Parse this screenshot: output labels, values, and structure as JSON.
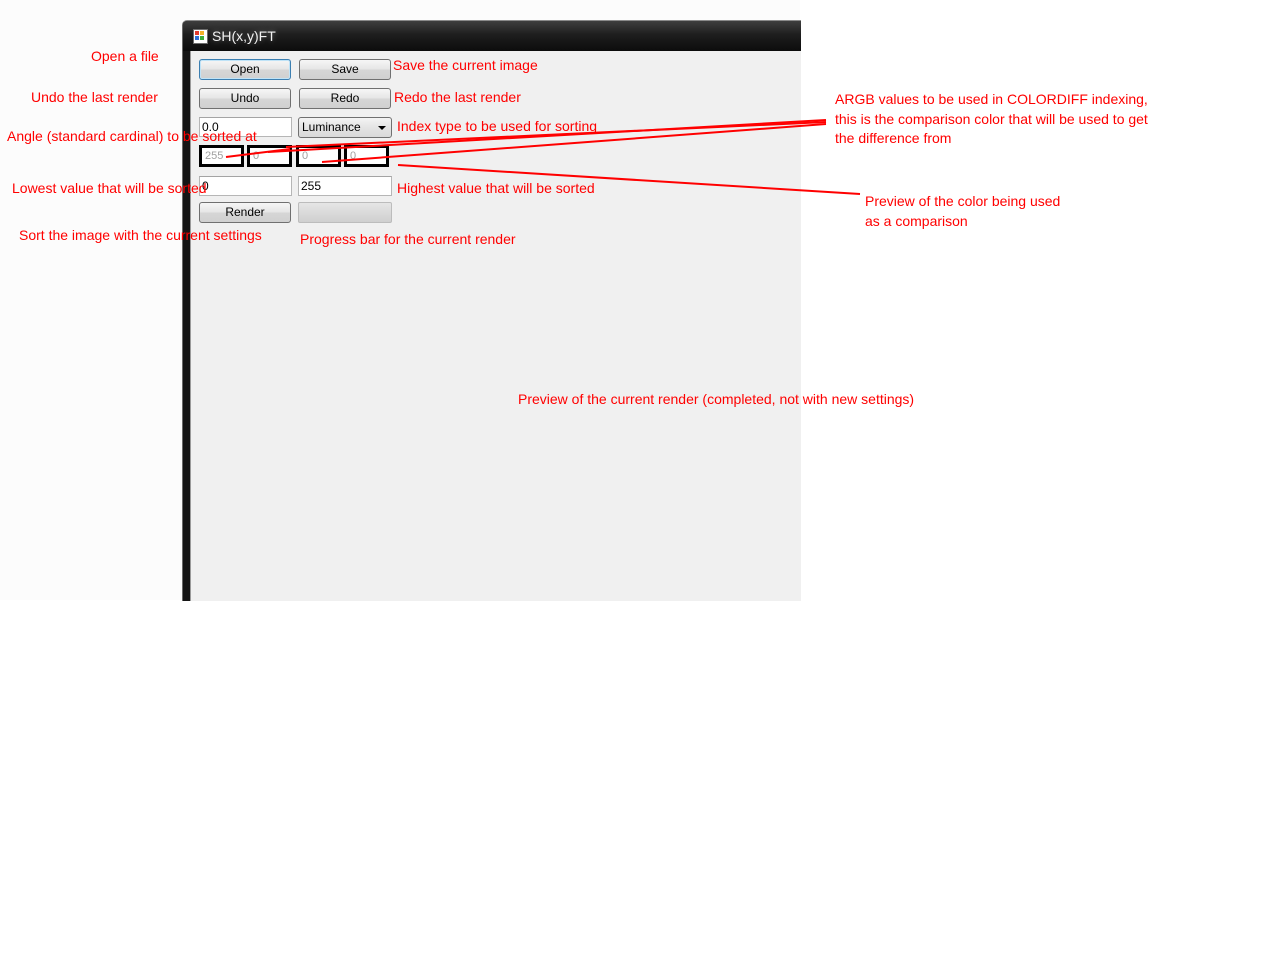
{
  "window": {
    "title": "SH(x,y)FT"
  },
  "form": {
    "open_label": "Open",
    "save_label": "Save",
    "undo_label": "Undo",
    "redo_label": "Redo",
    "angle_value": "0.0",
    "index_type_selected": "Luminance",
    "argb_values": [
      "255",
      "0",
      "0",
      "0"
    ],
    "low_value": "0",
    "high_value": "255",
    "render_label": "Render",
    "progress_fraction": 0
  },
  "annotations": {
    "open": "Open a file",
    "save": "Save the current image",
    "undo": "Undo the last render",
    "redo": "Redo the last render",
    "angle": "Angle (standard cardinal) to be sorted at",
    "index_type": "Index type to be used for sorting",
    "argb_line1": "ARGB values to be used in COLORDIFF indexing,",
    "argb_line2": "this is the comparison color that will be used to get",
    "argb_line3": "the difference from",
    "low": "Lowest value that will be sorted",
    "high": "Highest value that will be sorted",
    "color_preview_line1": "Preview of the color being used",
    "color_preview_line2": "as a comparison",
    "render": "Sort the image with the current settings",
    "progress": "Progress bar for the current render",
    "render_preview": "Preview of the current render (completed, not with new settings)"
  },
  "colors": {
    "annotation": "#ff0000",
    "argb_preview": "#000000",
    "window_client": "#f0f0f0"
  }
}
